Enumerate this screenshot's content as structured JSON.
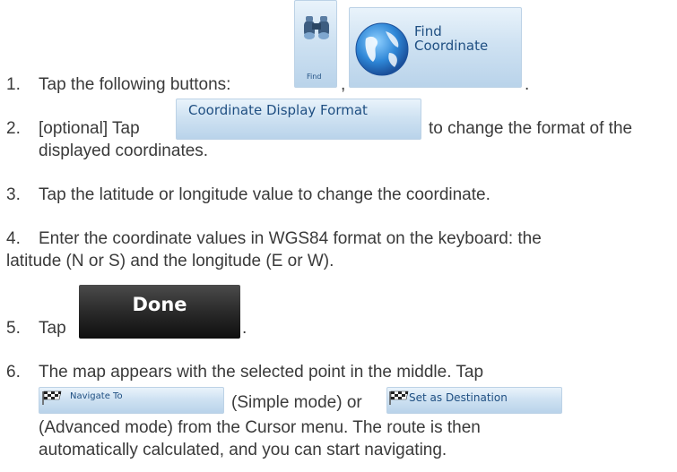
{
  "steps": [
    {
      "num": "1.",
      "before": "Tap the following buttons:",
      "sep": ",",
      "after": "."
    },
    {
      "num": "2.",
      "before": "[optional] Tap",
      "after": "to change the format of the",
      "cont": "displayed coordinates."
    },
    {
      "num": "3.",
      "text": "Tap the latitude or longitude value to change the coordinate."
    },
    {
      "num": "4.",
      "line1": "Enter the coordinate values in WGS84 format on the keyboard: the",
      "line2": "latitude (N or S) and the longitude (E or W)."
    },
    {
      "num": "5.",
      "before": "Tap",
      "after": "."
    },
    {
      "num": "6.",
      "line1": "The map appears with the selected point in the middle. Tap",
      "mid1": "(Simple mode) or",
      "line3": "(Advanced mode) from the Cursor menu. The route is then",
      "line4": "automatically calculated, and you can start navigating."
    }
  ],
  "buttons": {
    "find": {
      "label": "Find",
      "icon": "binoculars-icon"
    },
    "find_coordinate": {
      "line1": "Find",
      "line2": "Coordinate",
      "icon": "globe-icon"
    },
    "coordinate_display_format": {
      "label": "Coordinate Display Format"
    },
    "done": {
      "label": "Done"
    },
    "navigate_to": {
      "label": "Navigate To",
      "icon": "checkered-flag-icon"
    },
    "set_as_destination": {
      "label": "Set as Destination",
      "icon": "checkered-flag-icon"
    }
  }
}
